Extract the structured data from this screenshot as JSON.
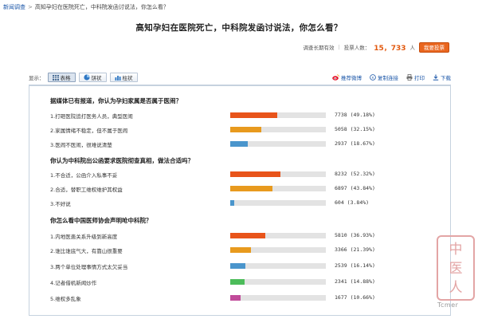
{
  "breadcrumb": {
    "home": "新闻调查",
    "separator": ">",
    "current": "高知孕妇在医院死亡，中科院发函讨说法，你怎么看？"
  },
  "survey": {
    "title": "高知孕妇在医院死亡，中科院发函讨说法，你怎么看？",
    "status": "调查长期有效",
    "participants_label": "投票人数：",
    "participants_count": "15，733",
    "participants_unit": "人",
    "vote_button": "我要投票"
  },
  "toolbar": {
    "display_label": "显示：",
    "views": [
      {
        "label": "表格",
        "icon": "table-icon",
        "active": true
      },
      {
        "label": "饼状",
        "icon": "pie-icon",
        "active": false
      },
      {
        "label": "柱状",
        "icon": "bar-icon",
        "active": false
      }
    ],
    "actions": [
      {
        "label": "推荐微博",
        "icon": "weibo-icon"
      },
      {
        "label": "复制连接",
        "icon": "link-icon"
      },
      {
        "label": "打印",
        "icon": "print-icon"
      },
      {
        "label": "下载",
        "icon": "download-icon"
      }
    ]
  },
  "questions": [
    {
      "title": "据媒体已有报道，你认为孕妇家属是否属于医闹？",
      "options": [
        {
          "label": "1.打砸医院追打医务人员，典型医闹",
          "votes": "7738",
          "percent": "(49.18%)",
          "value": 49.18,
          "color": "#e8541a"
        },
        {
          "label": "2.家属情绪不稳定，但不属于医闹",
          "votes": "5058",
          "percent": "(32.15%)",
          "value": 32.15,
          "color": "#e89a1e"
        },
        {
          "label": "3.医闹不医闹，很难说清楚",
          "votes": "2937",
          "percent": "(18.67%)",
          "value": 18.67,
          "color": "#4a95cc"
        }
      ]
    },
    {
      "title": "你认为中科院出公函要求医院彻查真相，做法合适吗？",
      "options": [
        {
          "label": "1.不合适，公函介入私事不妥",
          "votes": "8232",
          "percent": "(52.32%)",
          "value": 52.32,
          "color": "#e8541a"
        },
        {
          "label": "2.合适，替职工维权维护其权益",
          "votes": "6897",
          "percent": "(43.84%)",
          "value": 43.84,
          "color": "#e89a1e"
        },
        {
          "label": "3.不好说",
          "votes": "604",
          "percent": "(3.84%)",
          "value": 3.84,
          "color": "#4a95cc"
        }
      ]
    },
    {
      "title": "你怎么看中国医师协会声明呛中科院？",
      "options": [
        {
          "label": "1.内地医患关系升级到新高度",
          "votes": "5810",
          "percent": "(36.93%)",
          "value": 36.93,
          "color": "#e8541a"
        },
        {
          "label": "2.谁比谁底气大，有靠山很重要",
          "votes": "3366",
          "percent": "(21.39%)",
          "value": 21.39,
          "color": "#e89a1e"
        },
        {
          "label": "3.两个单位处理事情方式太欠妥当",
          "votes": "2539",
          "percent": "(16.14%)",
          "value": 16.14,
          "color": "#4a95cc"
        },
        {
          "label": "4.记者借机新闻炒作",
          "votes": "2341",
          "percent": "(14.88%)",
          "value": 14.88,
          "color": "#4cbc5a"
        },
        {
          "label": "5.维权多乱象",
          "votes": "1677",
          "percent": "(10.66%)",
          "value": 10.66,
          "color": "#c14b9a"
        }
      ]
    }
  ],
  "watermark": {
    "seal_text": "中医人",
    "text": "Tcmer"
  }
}
